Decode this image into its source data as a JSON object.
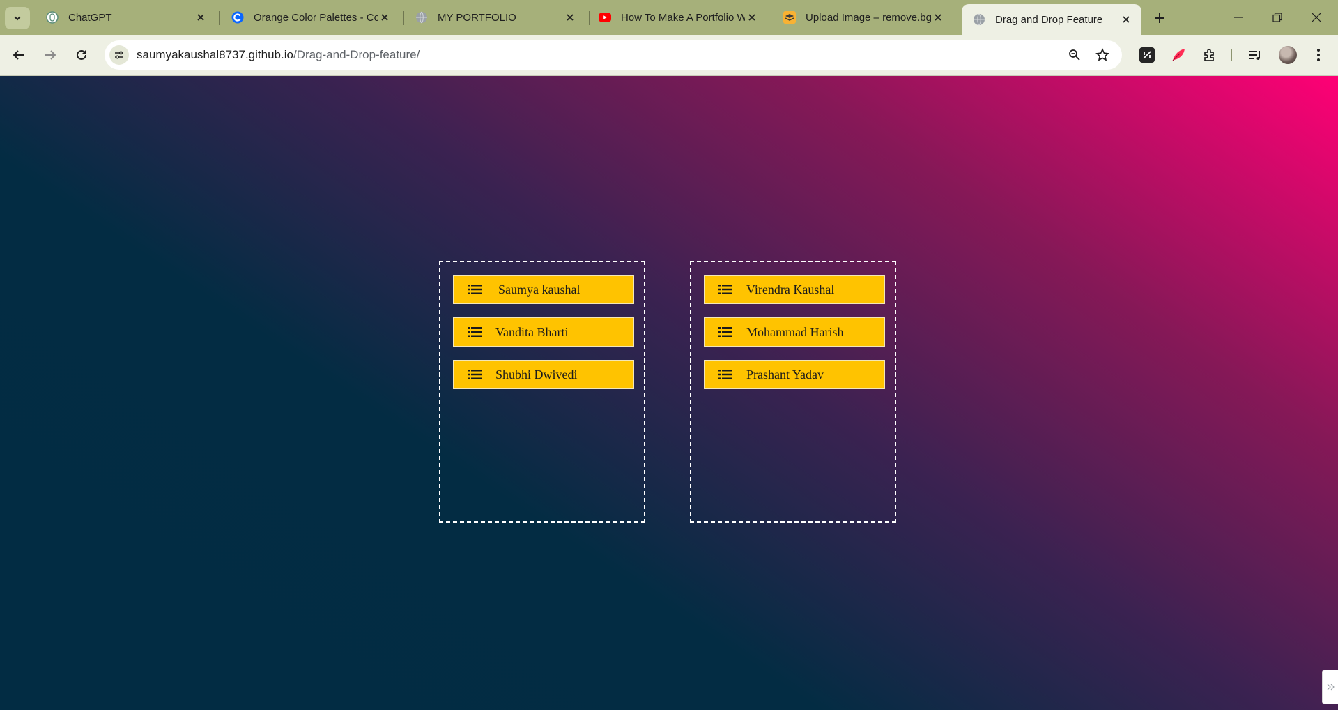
{
  "browser": {
    "tabs": [
      {
        "title": "ChatGPT",
        "icon": "chatgpt-icon",
        "active": false
      },
      {
        "title": "Orange Color Palettes - Co",
        "icon": "coolors-icon",
        "active": false
      },
      {
        "title": "MY PORTFOLIO",
        "icon": "globe-icon",
        "active": false
      },
      {
        "title": "How To Make A Portfolio W",
        "icon": "youtube-icon",
        "active": false
      },
      {
        "title": "Upload Image – remove.bg",
        "icon": "removebg-icon",
        "active": false
      },
      {
        "title": "Drag and Drop Feature",
        "icon": "globe-icon",
        "active": true
      }
    ],
    "url_host": "saumyakaushal8737.github.io",
    "url_path": "/Drag-and-Drop-feature/",
    "frame_color": "#a6b07a",
    "toolbar_color": "#eef0e4"
  },
  "page": {
    "background_colors": [
      "#022c43",
      "#3b2251",
      "#ff0075"
    ],
    "card_color": "#ffc300",
    "lists": [
      {
        "items": [
          "Saumya kaushal",
          "Vandita Bharti",
          "Shubhi Dwivedi"
        ]
      },
      {
        "items": [
          "Virendra Kaushal",
          "Mohammad Harish",
          "Prashant Yadav"
        ]
      }
    ]
  }
}
